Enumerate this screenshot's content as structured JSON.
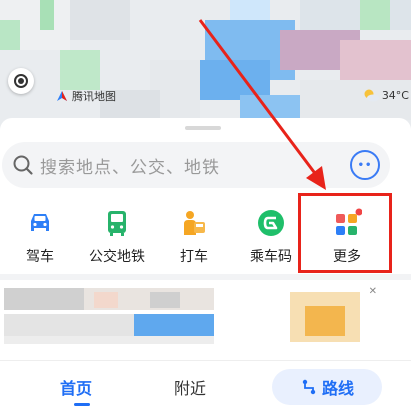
{
  "map": {
    "brand_label": "腾讯地图",
    "weather_temp": "34°C"
  },
  "search": {
    "placeholder": "搜索地点、公交、地铁",
    "assistant_icon": "assistant-face-icon"
  },
  "quick_actions": [
    {
      "label": "驾车",
      "icon": "car-icon",
      "color": "#2d7ff7"
    },
    {
      "label": "公交地铁",
      "icon": "bus-icon",
      "color": "#27b36b"
    },
    {
      "label": "打车",
      "icon": "taxi-icon",
      "color": "#f5a623"
    },
    {
      "label": "乘车码",
      "icon": "ride-code-icon",
      "color": "#1fbf6a"
    },
    {
      "label": "更多",
      "icon": "grid-more-icon",
      "color": "#3a7bf5"
    }
  ],
  "banner": {
    "close_label": "✕"
  },
  "tabbar": {
    "home": "首页",
    "nearby": "附近",
    "route": "路线"
  },
  "colors": {
    "accent": "#1f6ef5",
    "highlight": "#e8231a"
  }
}
